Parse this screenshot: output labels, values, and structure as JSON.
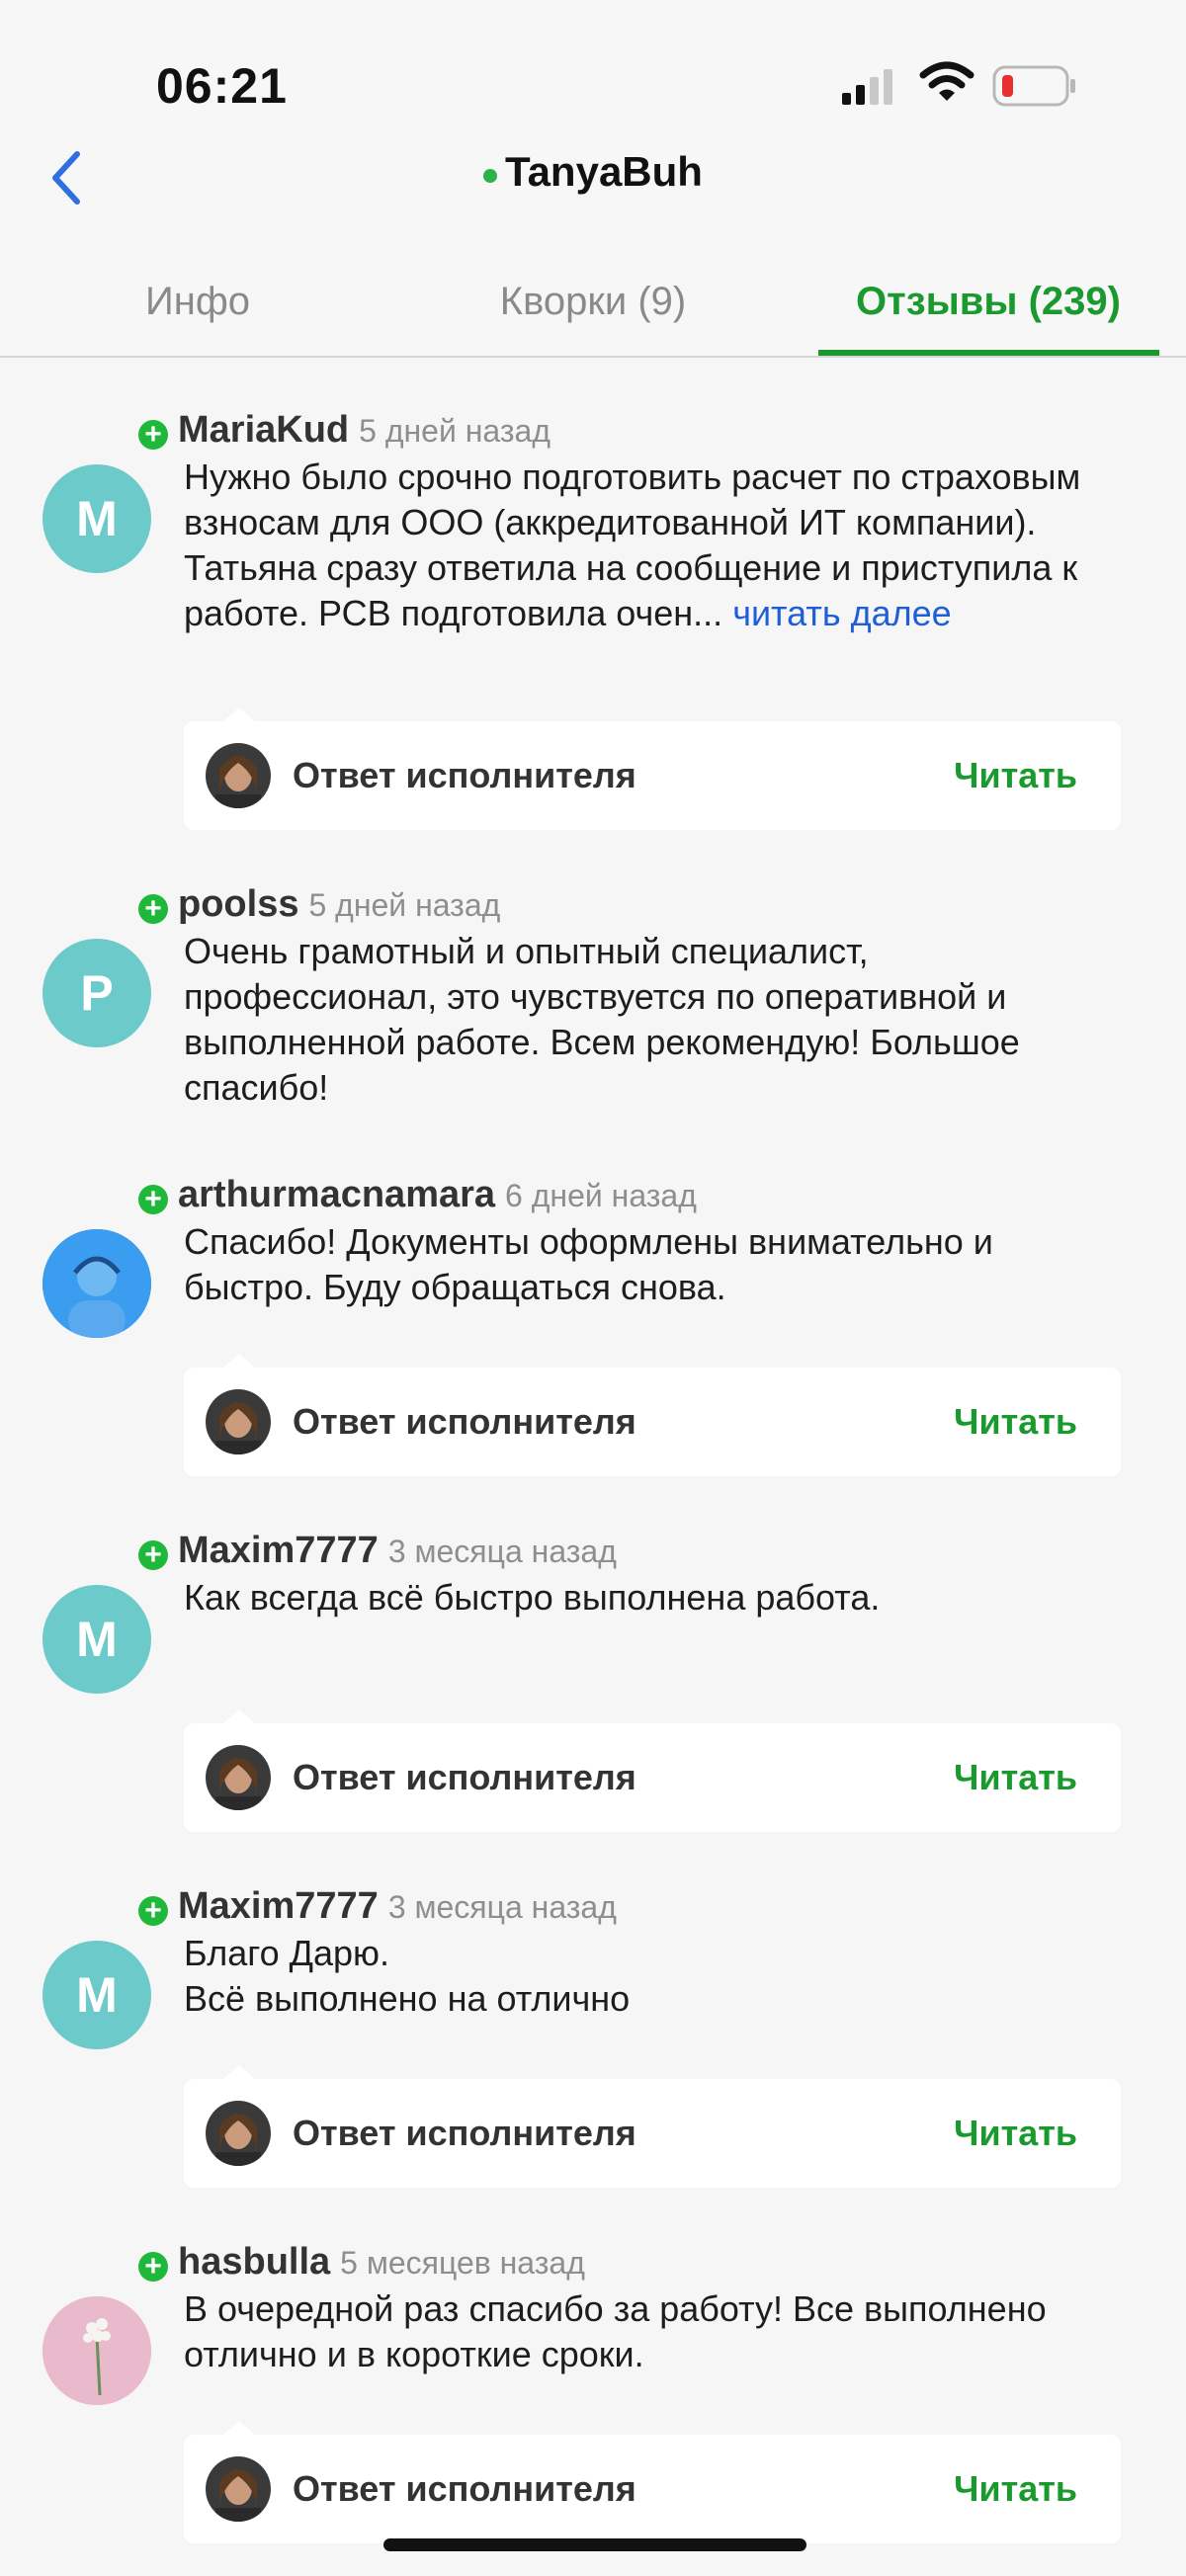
{
  "status_bar": {
    "time": "06:21"
  },
  "header": {
    "title": "TanyaBuh"
  },
  "tabs": [
    {
      "label": "Инфо"
    },
    {
      "label": "Кворки (9)"
    },
    {
      "label": "Отзывы (239)"
    }
  ],
  "reply_label": "Ответ исполнителя",
  "reply_action": "Читать",
  "reviews": [
    {
      "user": "MariaKud",
      "ago": "5 дней назад",
      "avatar_letter": "M",
      "text": "Нужно было срочно подготовить расчет по страховым взносам для ООО (аккредитованной ИТ компании). Татьяна сразу ответила на сообщение и приступила к работе. РСВ подготовила очен... ",
      "more": "читать далее"
    },
    {
      "user": "poolss",
      "ago": "5 дней назад",
      "avatar_letter": "P",
      "text": "Очень грамотный и опытный специалист, профессионал, это чувствуется по оперативной и выполненной работе. Всем рекомендую! Большое спасибо!"
    },
    {
      "user": "arthurmacnamara",
      "ago": "6 дней назад",
      "text": "Спасибо! Документы оформлены внимательно и быстро. Буду обращаться снова."
    },
    {
      "user": "Maxim7777",
      "ago": "3 месяца назад",
      "avatar_letter": "M",
      "text": "Как всегда всё быстро выполнена работа."
    },
    {
      "user": "Maxim7777",
      "ago": "3 месяца назад",
      "avatar_letter": "M",
      "text": "Благо Дарю.",
      "text2": "Всё выполнено на отлично"
    },
    {
      "user": "hasbulla",
      "ago": "5 месяцев назад",
      "text": "В очередной раз спасибо за работу! Все выполнено отлично и в короткие сроки."
    }
  ],
  "colors": {
    "accent_green": "#1a9a2e",
    "link_blue": "#1e5fd8",
    "avatar_teal": "#6ccaca",
    "online_green": "#2bb24c"
  }
}
